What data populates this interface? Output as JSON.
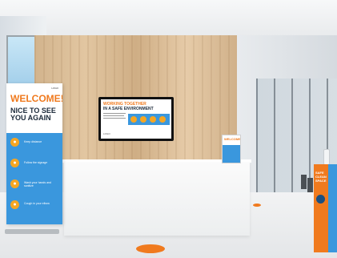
{
  "banner": {
    "logo_text": "LOGO",
    "title_line1": "WELCOME!",
    "title_line2": "NICE TO SEE YOU AGAIN",
    "items": [
      "Keep distance",
      "Follow the signage",
      "Wash your hands and sanitize",
      "Cough in your elbow"
    ]
  },
  "tv": {
    "title_line1": "WORKING TOGETHER",
    "title_line2": "IN A SAFE ENVIRONMENT",
    "footer_text": "LOGO"
  },
  "sign": {
    "title": "WELCOME"
  },
  "right_banner": {
    "text": "SAFE CLEAN SPACE"
  },
  "colors": {
    "accent_orange": "#f07a1e",
    "accent_blue": "#3a97dd",
    "dark_navy": "#1c2a3a"
  },
  "icons": [
    "people-distance-icon",
    "footprints-icon",
    "hands-wash-icon",
    "cough-icon",
    "smile-icon"
  ]
}
